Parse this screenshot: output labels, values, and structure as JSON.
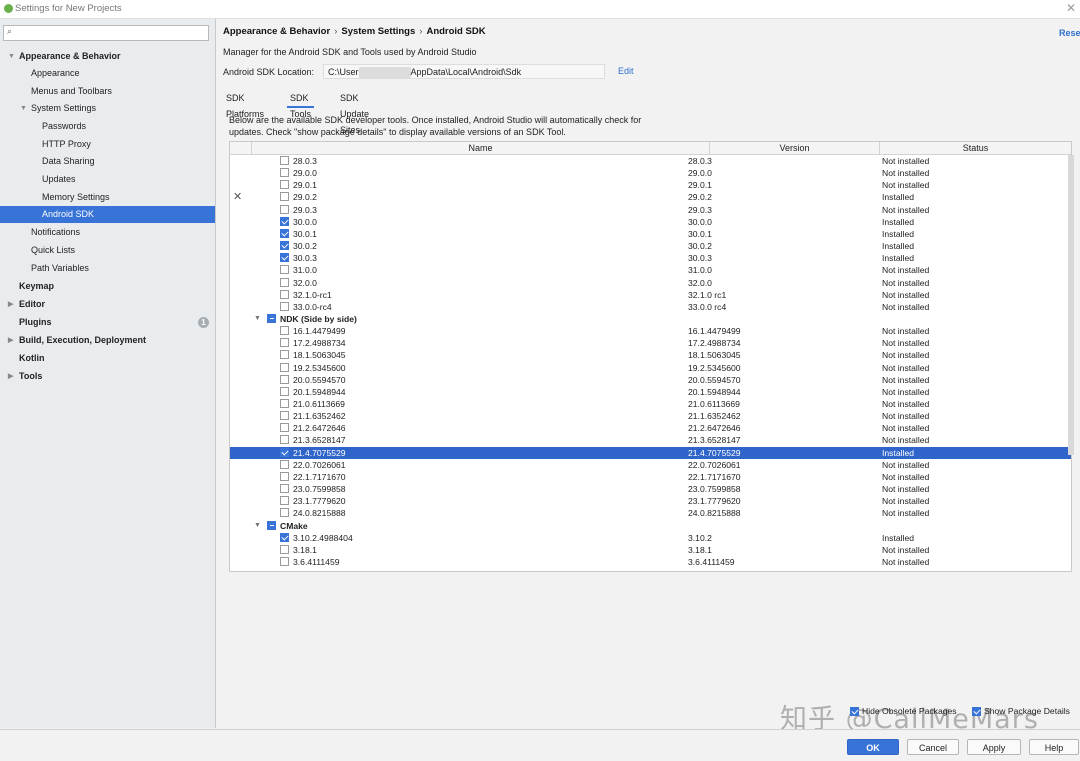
{
  "window": {
    "title": "Settings for New Projects"
  },
  "sidebar": {
    "search_placeholder": "Q",
    "items": [
      {
        "label": "Appearance & Behavior",
        "level": 0,
        "bold": true,
        "arrow": "▼"
      },
      {
        "label": "Appearance",
        "level": 1
      },
      {
        "label": "Menus and Toolbars",
        "level": 1
      },
      {
        "label": "System Settings",
        "level": 1,
        "arrow": "▼"
      },
      {
        "label": "Passwords",
        "level": 2
      },
      {
        "label": "HTTP Proxy",
        "level": 2
      },
      {
        "label": "Data Sharing",
        "level": 2
      },
      {
        "label": "Updates",
        "level": 2
      },
      {
        "label": "Memory Settings",
        "level": 2
      },
      {
        "label": "Android SDK",
        "level": 2,
        "selected": true
      },
      {
        "label": "Notifications",
        "level": 1
      },
      {
        "label": "Quick Lists",
        "level": 1
      },
      {
        "label": "Path Variables",
        "level": 1
      },
      {
        "label": "Keymap",
        "level": 0,
        "bold": true
      },
      {
        "label": "Editor",
        "level": 0,
        "bold": true,
        "arrow": "▶"
      },
      {
        "label": "Plugins",
        "level": 0,
        "bold": true,
        "badge": "1"
      },
      {
        "label": "Build, Execution, Deployment",
        "level": 0,
        "bold": true,
        "arrow": "▶"
      },
      {
        "label": "Kotlin",
        "level": 0,
        "bold": true
      },
      {
        "label": "Tools",
        "level": 0,
        "bold": true,
        "arrow": "▶"
      }
    ]
  },
  "breadcrumb": [
    "Appearance & Behavior",
    "System Settings",
    "Android SDK"
  ],
  "breadcrumb_sep": "›",
  "reset_label": "Rese",
  "description": "Manager for the Android SDK and Tools used by Android Studio",
  "sdk_location": {
    "label": "Android SDK Location:",
    "value_prefix": "C:\\User",
    "value_suffix": "AppData\\Local\\Android\\Sdk",
    "edit_label": "Edit"
  },
  "tabs": [
    {
      "label": "SDK Platforms",
      "active": false
    },
    {
      "label": "SDK Tools",
      "active": true
    },
    {
      "label": "SDK Update Sites",
      "active": false
    }
  ],
  "info_text": "Below are the available SDK developer tools. Once installed, Android Studio will automatically check for updates. Check \"show package details\" to display available versions of an SDK Tool.",
  "table": {
    "headers": [
      "Name",
      "Version",
      "Status"
    ],
    "rows": [
      {
        "name": "28.0.3",
        "version": "28.0.3",
        "status": "Not installed",
        "checked": false,
        "indent": 2
      },
      {
        "name": "29.0.0",
        "version": "29.0.0",
        "status": "Not installed",
        "checked": false,
        "indent": 2
      },
      {
        "name": "29.0.1",
        "version": "29.0.1",
        "status": "Not installed",
        "checked": false,
        "indent": 2
      },
      {
        "name": "29.0.2",
        "version": "29.0.2",
        "status": "Installed",
        "checked": false,
        "indent": 2
      },
      {
        "name": "29.0.3",
        "version": "29.0.3",
        "status": "Not installed",
        "checked": false,
        "indent": 2
      },
      {
        "name": "30.0.0",
        "version": "30.0.0",
        "status": "Installed",
        "checked": true,
        "indent": 2
      },
      {
        "name": "30.0.1",
        "version": "30.0.1",
        "status": "Installed",
        "checked": true,
        "indent": 2
      },
      {
        "name": "30.0.2",
        "version": "30.0.2",
        "status": "Installed",
        "checked": true,
        "indent": 2
      },
      {
        "name": "30.0.3",
        "version": "30.0.3",
        "status": "Installed",
        "checked": true,
        "indent": 2
      },
      {
        "name": "31.0.0",
        "version": "31.0.0",
        "status": "Not installed",
        "checked": false,
        "indent": 2
      },
      {
        "name": "32.0.0",
        "version": "32.0.0",
        "status": "Not installed",
        "checked": false,
        "indent": 2
      },
      {
        "name": "32.1.0-rc1",
        "version": "32.1.0 rc1",
        "status": "Not installed",
        "checked": false,
        "indent": 2
      },
      {
        "name": "33.0.0-rc4",
        "version": "33.0.0 rc4",
        "status": "Not installed",
        "checked": false,
        "indent": 2
      },
      {
        "name": "NDK (Side by side)",
        "version": "",
        "status": "",
        "group": true,
        "mixed": true,
        "indent": 1
      },
      {
        "name": "16.1.4479499",
        "version": "16.1.4479499",
        "status": "Not installed",
        "checked": false,
        "indent": 2
      },
      {
        "name": "17.2.4988734",
        "version": "17.2.4988734",
        "status": "Not installed",
        "checked": false,
        "indent": 2
      },
      {
        "name": "18.1.5063045",
        "version": "18.1.5063045",
        "status": "Not installed",
        "checked": false,
        "indent": 2
      },
      {
        "name": "19.2.5345600",
        "version": "19.2.5345600",
        "status": "Not installed",
        "checked": false,
        "indent": 2
      },
      {
        "name": "20.0.5594570",
        "version": "20.0.5594570",
        "status": "Not installed",
        "checked": false,
        "indent": 2
      },
      {
        "name": "20.1.5948944",
        "version": "20.1.5948944",
        "status": "Not installed",
        "checked": false,
        "indent": 2
      },
      {
        "name": "21.0.6113669",
        "version": "21.0.6113669",
        "status": "Not installed",
        "checked": false,
        "indent": 2
      },
      {
        "name": "21.1.6352462",
        "version": "21.1.6352462",
        "status": "Not installed",
        "checked": false,
        "indent": 2
      },
      {
        "name": "21.2.6472646",
        "version": "21.2.6472646",
        "status": "Not installed",
        "checked": false,
        "indent": 2
      },
      {
        "name": "21.3.6528147",
        "version": "21.3.6528147",
        "status": "Not installed",
        "checked": false,
        "indent": 2
      },
      {
        "name": "21.4.7075529",
        "version": "21.4.7075529",
        "status": "Installed",
        "checked": true,
        "selected": true,
        "indent": 2
      },
      {
        "name": "22.0.7026061",
        "version": "22.0.7026061",
        "status": "Not installed",
        "checked": false,
        "indent": 2
      },
      {
        "name": "22.1.7171670",
        "version": "22.1.7171670",
        "status": "Not installed",
        "checked": false,
        "indent": 2
      },
      {
        "name": "23.0.7599858",
        "version": "23.0.7599858",
        "status": "Not installed",
        "checked": false,
        "indent": 2
      },
      {
        "name": "23.1.7779620",
        "version": "23.1.7779620",
        "status": "Not installed",
        "checked": false,
        "indent": 2
      },
      {
        "name": "24.0.8215888",
        "version": "24.0.8215888",
        "status": "Not installed",
        "checked": false,
        "indent": 2
      },
      {
        "name": "CMake",
        "version": "",
        "status": "",
        "group": true,
        "mixed": true,
        "indent": 1
      },
      {
        "name": "3.10.2.4988404",
        "version": "3.10.2",
        "status": "Installed",
        "checked": true,
        "indent": 2
      },
      {
        "name": "3.18.1",
        "version": "3.18.1",
        "status": "Not installed",
        "checked": false,
        "indent": 2
      },
      {
        "name": "3.6.4111459",
        "version": "3.6.4111459",
        "status": "Not installed",
        "checked": false,
        "indent": 2
      }
    ]
  },
  "options": {
    "hide_obsolete": "Hide Obsolete Packages",
    "show_details": "Show Package Details"
  },
  "watermark": "知乎 @CallMeMars",
  "buttons": {
    "ok": "OK",
    "cancel": "Cancel",
    "apply": "Apply",
    "help": "Help"
  },
  "colors": {
    "accent": "#3874d8",
    "selection": "#2f65ca",
    "link": "#2f6fce"
  }
}
